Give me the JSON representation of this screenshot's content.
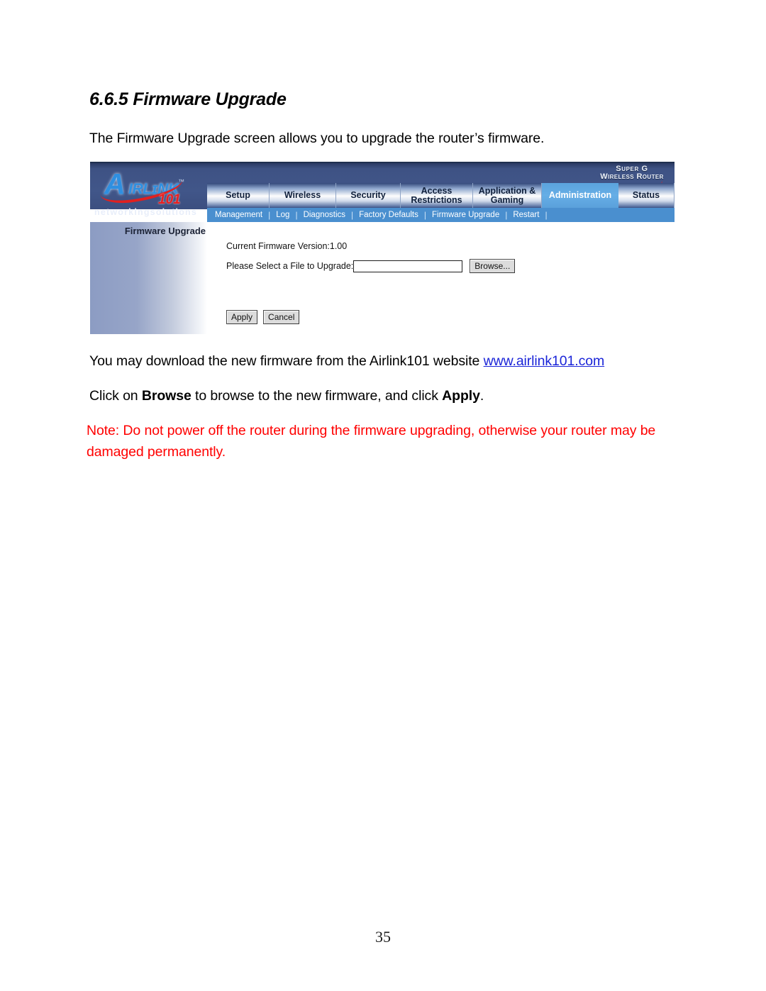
{
  "document": {
    "heading": "6.6.5 Firmware Upgrade",
    "intro": "The Firmware Upgrade screen allows you to upgrade the router’s firmware.",
    "download_prefix": "You may download the new firmware from the Airlink101 website ",
    "download_link": "www.airlink101.com",
    "click_part1": "Click on ",
    "click_browse": "Browse",
    "click_part2": " to browse to the new firmware, and click ",
    "click_apply": "Apply",
    "click_part3": ".",
    "note": "Note: Do not power off the router during the firmware upgrading, otherwise your router may be damaged permanently.",
    "page_number": "35",
    "note_color": "#ff0000",
    "link_color": "#1a24d8"
  },
  "router_ui": {
    "brand": {
      "logo_a": "A",
      "logo_rest": "IRLɪNK",
      "logo_101": "101",
      "logo_tm": "™",
      "tagline": "networkingsolutions"
    },
    "badge": {
      "line1": "Super G",
      "line2": "Wireless Router"
    },
    "tabs": [
      {
        "label": "Setup",
        "active": false
      },
      {
        "label": "Wireless",
        "active": false
      },
      {
        "label": "Security",
        "active": false
      },
      {
        "label": "Access Restrictions",
        "active": false
      },
      {
        "label": "Application & Gaming",
        "active": false
      },
      {
        "label": "Administration",
        "active": true
      },
      {
        "label": "Status",
        "active": false
      }
    ],
    "subnav": [
      "Management",
      "Log",
      "Diagnostics",
      "Factory Defaults",
      "Firmware Upgrade",
      "Restart"
    ],
    "section_title": "Firmware Upgrade",
    "firmware_version_label": "Current Firmware Version:1.00",
    "file_label": "Please Select a File to Upgrade:",
    "file_value": "",
    "file_placeholder": "",
    "browse_label": "Browse...",
    "apply_label": "Apply",
    "cancel_label": "Cancel",
    "accent_active_tab": "#5ba3dd",
    "header_bg": "#3e5284",
    "subnav_bg": "#4a8fcf"
  }
}
